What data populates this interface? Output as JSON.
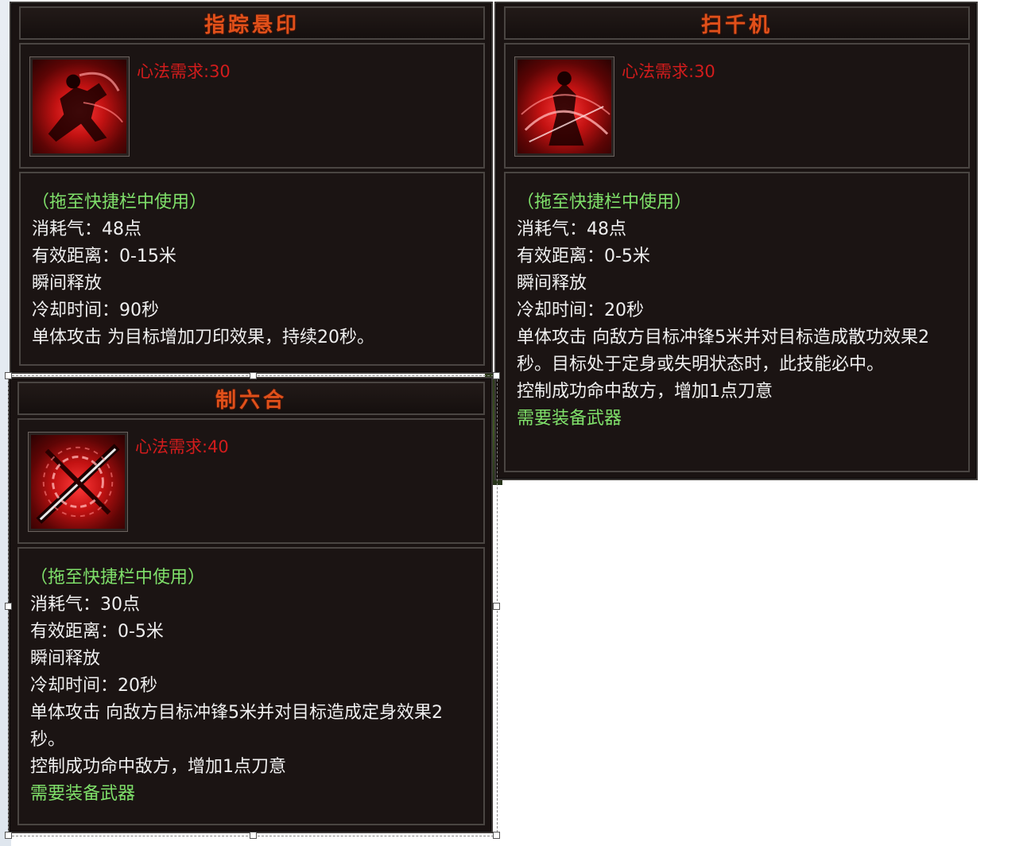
{
  "panels": [
    {
      "title": "指踪悬印",
      "requirement": "心法需求:30",
      "icon": "running-swordsman-icon",
      "hint": "（拖至快捷栏中使用）",
      "lines": [
        "消耗气：48点",
        "有效距离：0-15米",
        "瞬间释放",
        "冷却时间：90秒",
        "单体攻击 为目标增加刀印效果，持续20秒。"
      ],
      "weapon_note": ""
    },
    {
      "title": "扫千机",
      "requirement": "心法需求:30",
      "icon": "slashing-swordsman-icon",
      "hint": "（拖至快捷栏中使用）",
      "lines": [
        "消耗气：48点",
        "有效距离：0-5米",
        "瞬间释放",
        "冷却时间：20秒",
        "单体攻击 向敌方目标冲锋5米并对目标造成散功效果2秒。目标处于定身或失明状态时，此技能必中。",
        "控制成功命中敌方，增加1点刀意"
      ],
      "weapon_note": "需要装备武器"
    },
    {
      "title": "制六合",
      "requirement": "心法需求:40",
      "icon": "chained-blade-icon",
      "hint": "（拖至快捷栏中使用）",
      "lines": [
        "消耗气：30点",
        "有效距离：0-5米",
        "瞬间释放",
        "冷却时间：20秒",
        "单体攻击 向敌方目标冲锋5米并对目标造成定身效果2秒。",
        "控制成功命中敌方，增加1点刀意"
      ],
      "weapon_note": "需要装备武器"
    }
  ],
  "colors": {
    "title": "#e0501a",
    "requirement": "#d21c1c",
    "hint": "#7fe06a",
    "body_text": "#f0f0f0",
    "panel_bg": "#1a1312"
  }
}
